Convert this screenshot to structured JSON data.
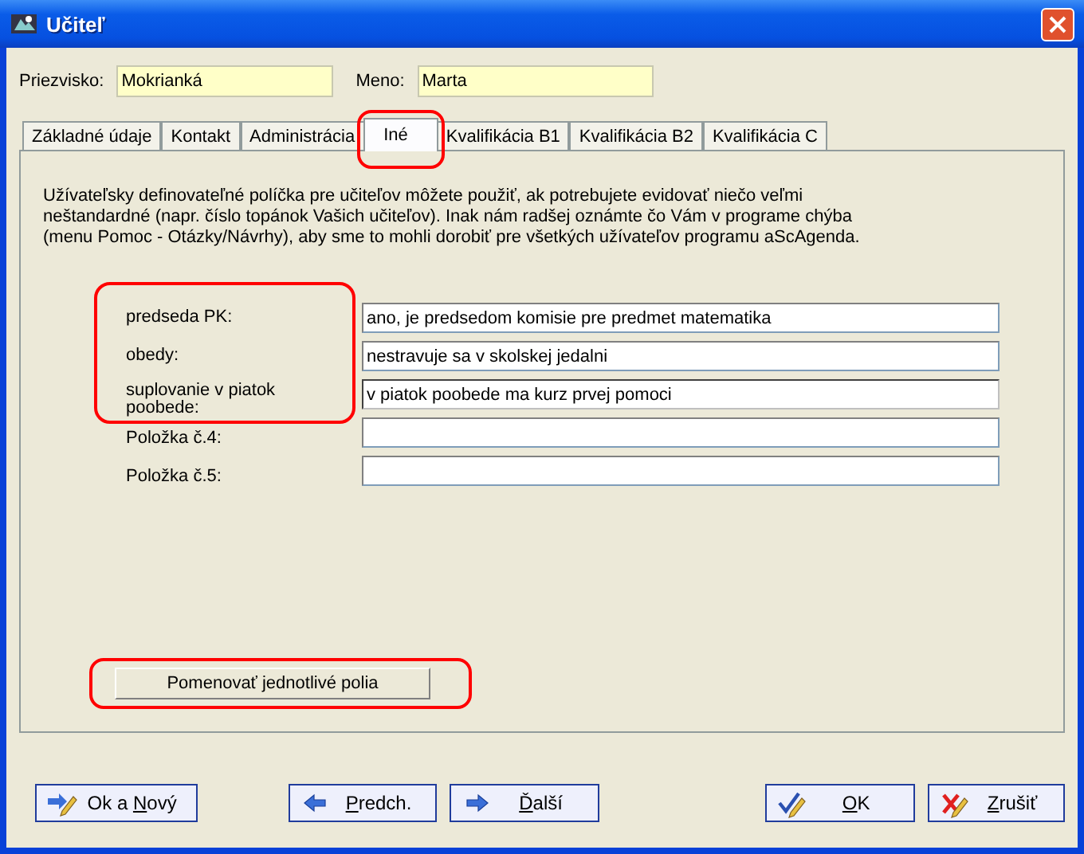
{
  "window": {
    "title": "Učiteľ"
  },
  "header_fields": [
    {
      "label": "Priezvisko:",
      "value": "Mokrianká"
    },
    {
      "label": "Meno:",
      "value": "Marta"
    }
  ],
  "tabs": [
    {
      "label": "Základné údaje",
      "selected": false,
      "circled": false
    },
    {
      "label": "Kontakt",
      "selected": false,
      "circled": false
    },
    {
      "label": "Administrácia",
      "selected": false,
      "circled": false
    },
    {
      "label": "Iné",
      "selected": true,
      "circled": true
    },
    {
      "label": "Kvalifikácia B1",
      "selected": false,
      "circled": false
    },
    {
      "label": "Kvalifikácia B2",
      "selected": false,
      "circled": false
    },
    {
      "label": "Kvalifikácia C",
      "selected": false,
      "circled": false
    }
  ],
  "info_text": "Užívateľsky definovateľné políčka pre učiteľov môžete použiť, ak potrebujete evidovať niečo veľmi neštandardné (napr. číslo topánok Vašich učiteľov). Inak nám radšej oznámte čo Vám v programe chýba (menu Pomoc - Otázky/Návrhy), aby sme to mohli dorobiť pre všetkých užívateľov programu aScAgenda.",
  "custom_fields": [
    {
      "label": "predseda PK:",
      "value": "ano, je predsedom komisie pre predmet matematika",
      "circled": true,
      "focused": false
    },
    {
      "label": "obedy:",
      "value": "nestravuje sa v skolskej jedalni",
      "circled": true,
      "focused": false
    },
    {
      "label": "suplovanie v piatok poobede:",
      "value": "v piatok poobede ma kurz prvej pomoci",
      "circled": true,
      "focused": true
    },
    {
      "label": "Položka č.4:",
      "circled": false,
      "focused": false
    },
    {
      "label": "Položka č.5:",
      "circled": false,
      "focused": false
    }
  ],
  "rename_button": {
    "label": "Pomenovať jednotlivé polia",
    "circled": true
  },
  "buttons": [
    {
      "kind": "ok-new",
      "pre": "Ok a ",
      "key": "N",
      "post": "ový"
    },
    {
      "kind": "prev",
      "key": "P",
      "post": "redch."
    },
    {
      "kind": "next",
      "key": "Ď",
      "post": "alší"
    },
    {
      "kind": "ok",
      "key": "O",
      "post": "K"
    },
    {
      "kind": "cancel",
      "key": "Z",
      "post": "rušiť"
    }
  ]
}
